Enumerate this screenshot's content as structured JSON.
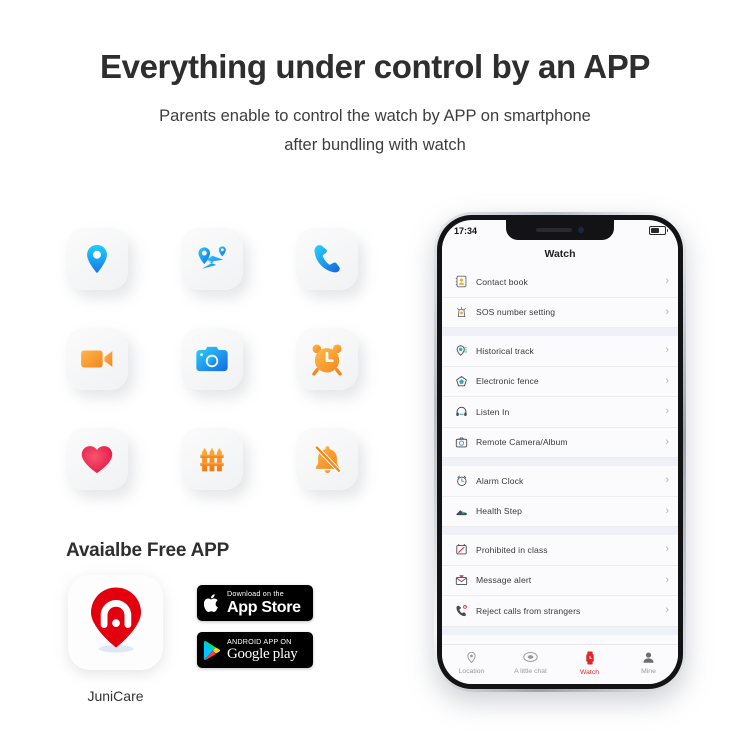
{
  "header": {
    "title": "Everything under control by an APP",
    "subtitle_line1": "Parents enable to control the watch by APP on smartphone",
    "subtitle_line2": "after bundling with watch"
  },
  "features": {
    "icons": [
      {
        "name": "location-pin-icon",
        "label": "Location pin"
      },
      {
        "name": "route-map-icon",
        "label": "Route map"
      },
      {
        "name": "phone-call-icon",
        "label": "Phone call"
      },
      {
        "name": "video-camera-icon",
        "label": "Video call"
      },
      {
        "name": "camera-icon",
        "label": "Camera"
      },
      {
        "name": "alarm-clock-icon",
        "label": "Alarm clock"
      },
      {
        "name": "heart-icon",
        "label": "Health"
      },
      {
        "name": "fence-icon",
        "label": "Electronic fence"
      },
      {
        "name": "bell-off-icon",
        "label": "Silent mode"
      }
    ]
  },
  "app_section": {
    "title": "Avaialbe Free APP",
    "app_name": "JuniCare",
    "app_logo_name": "junicare-logo",
    "badges": [
      {
        "name": "app-store-badge",
        "small": "Download on the",
        "big": "App Store",
        "glyph": "apple-icon"
      },
      {
        "name": "google-play-badge",
        "small": "ANDROID APP ON",
        "big": "Google play",
        "glyph": "play-triangle-icon"
      }
    ]
  },
  "phone": {
    "status": {
      "time": "17:34",
      "battery": "battery-icon"
    },
    "nav_title": "Watch",
    "groups": [
      {
        "rows": [
          {
            "label": "Contact book",
            "icon": "contact-book-icon",
            "color": "#f5a623"
          },
          {
            "label": "SOS number setting",
            "icon": "sos-alarm-icon",
            "color": "#f5a623"
          }
        ]
      },
      {
        "rows": [
          {
            "label": "Historical track",
            "icon": "historical-track-icon",
            "color": "#3aa8b5"
          },
          {
            "label": "Electronic fence",
            "icon": "electronic-fence-icon",
            "color": "#3aa8b5"
          },
          {
            "label": "Listen In",
            "icon": "listen-in-icon",
            "color": "#3aa8b5"
          },
          {
            "label": "Remote Camera/Album",
            "icon": "remote-camera-icon",
            "color": "#3aa8b5"
          }
        ]
      },
      {
        "rows": [
          {
            "label": "Alarm Clock",
            "icon": "alarm-clock-row-icon",
            "color": "#3aa8b5"
          },
          {
            "label": "Health Step",
            "icon": "health-step-icon",
            "color": "#3aa8b5"
          }
        ]
      },
      {
        "rows": [
          {
            "label": "Prohibited in class",
            "icon": "prohibited-class-icon",
            "color": "#e5252a"
          },
          {
            "label": "Message alert",
            "icon": "message-alert-icon",
            "color": "#e5252a"
          },
          {
            "label": "Reject calls from strangers",
            "icon": "reject-calls-icon",
            "color": "#e5252a"
          }
        ]
      }
    ],
    "tabs": [
      {
        "label": "Location",
        "icon": "tab-location-icon",
        "active": false
      },
      {
        "label": "A little chat",
        "icon": "tab-chat-icon",
        "active": false
      },
      {
        "label": "Watch",
        "icon": "tab-watch-icon",
        "active": true
      },
      {
        "label": "Mine",
        "icon": "tab-mine-icon",
        "active": false
      }
    ],
    "chevron": "›"
  },
  "colors": {
    "accent_red": "#e5252a",
    "accent_blue": "#2a9df4",
    "accent_orange": "#f79321",
    "heart_red": "#ef2b55",
    "text_dark": "#2e2e2e"
  }
}
